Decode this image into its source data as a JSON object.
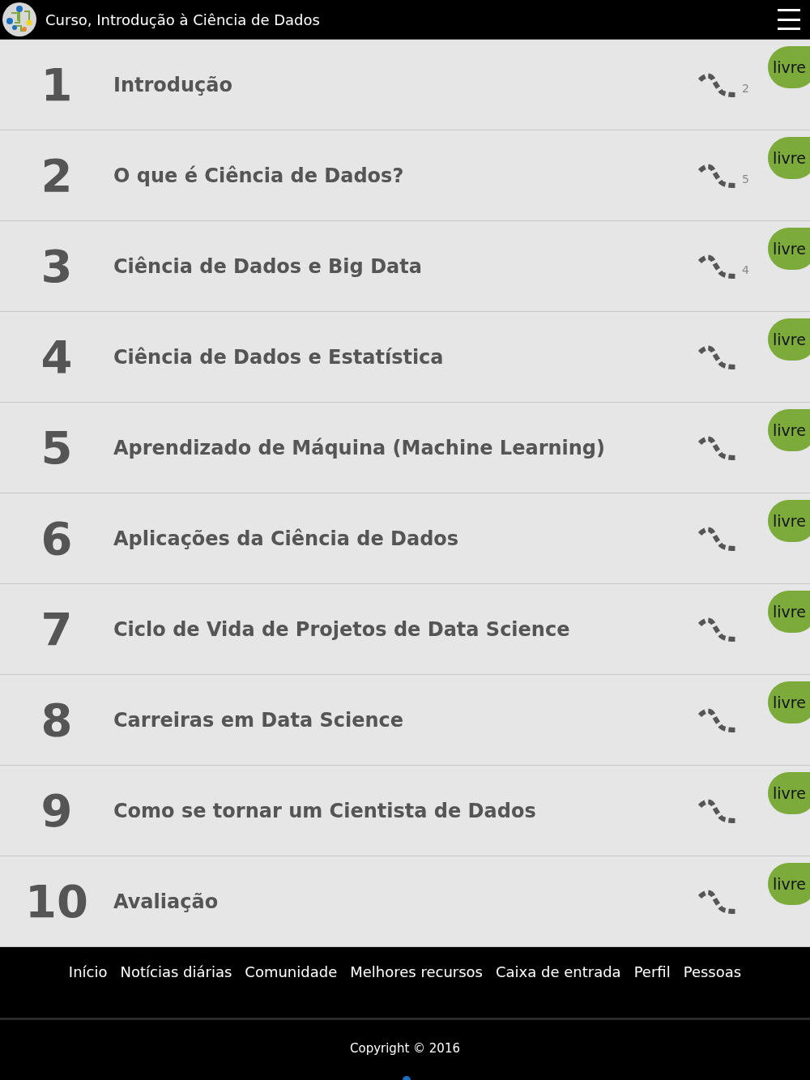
{
  "header": {
    "title": "Curso, Introdução à Ciência de Dados"
  },
  "lessons": [
    {
      "number": "1",
      "title": "Introdução",
      "count": "2",
      "badge": "livre"
    },
    {
      "number": "2",
      "title": "O que é Ciência de Dados?",
      "count": "5",
      "badge": "livre"
    },
    {
      "number": "3",
      "title": "Ciência de Dados e Big Data",
      "count": "4",
      "badge": "livre"
    },
    {
      "number": "4",
      "title": "Ciência de Dados e Estatística",
      "badge": "livre"
    },
    {
      "number": "5",
      "title": "Aprendizado de Máquina (Machine Learning)",
      "badge": "livre"
    },
    {
      "number": "6",
      "title": "Aplicações da Ciência de Dados",
      "badge": "livre"
    },
    {
      "number": "7",
      "title": "Ciclo de Vida de Projetos de Data Science",
      "badge": "livre"
    },
    {
      "number": "8",
      "title": "Carreiras em Data Science",
      "badge": "livre"
    },
    {
      "number": "9",
      "title": "Como se tornar um Cientista de Dados",
      "badge": "livre"
    },
    {
      "number": "10",
      "title": "Avaliação",
      "badge": "livre"
    }
  ],
  "footer_nav": [
    "Início",
    "Notícias diárias",
    "Comunidade",
    "Melhores recursos",
    "Caixa de entrada",
    "Perfil",
    "Pessoas"
  ],
  "copyright": "Copyright © 2016"
}
